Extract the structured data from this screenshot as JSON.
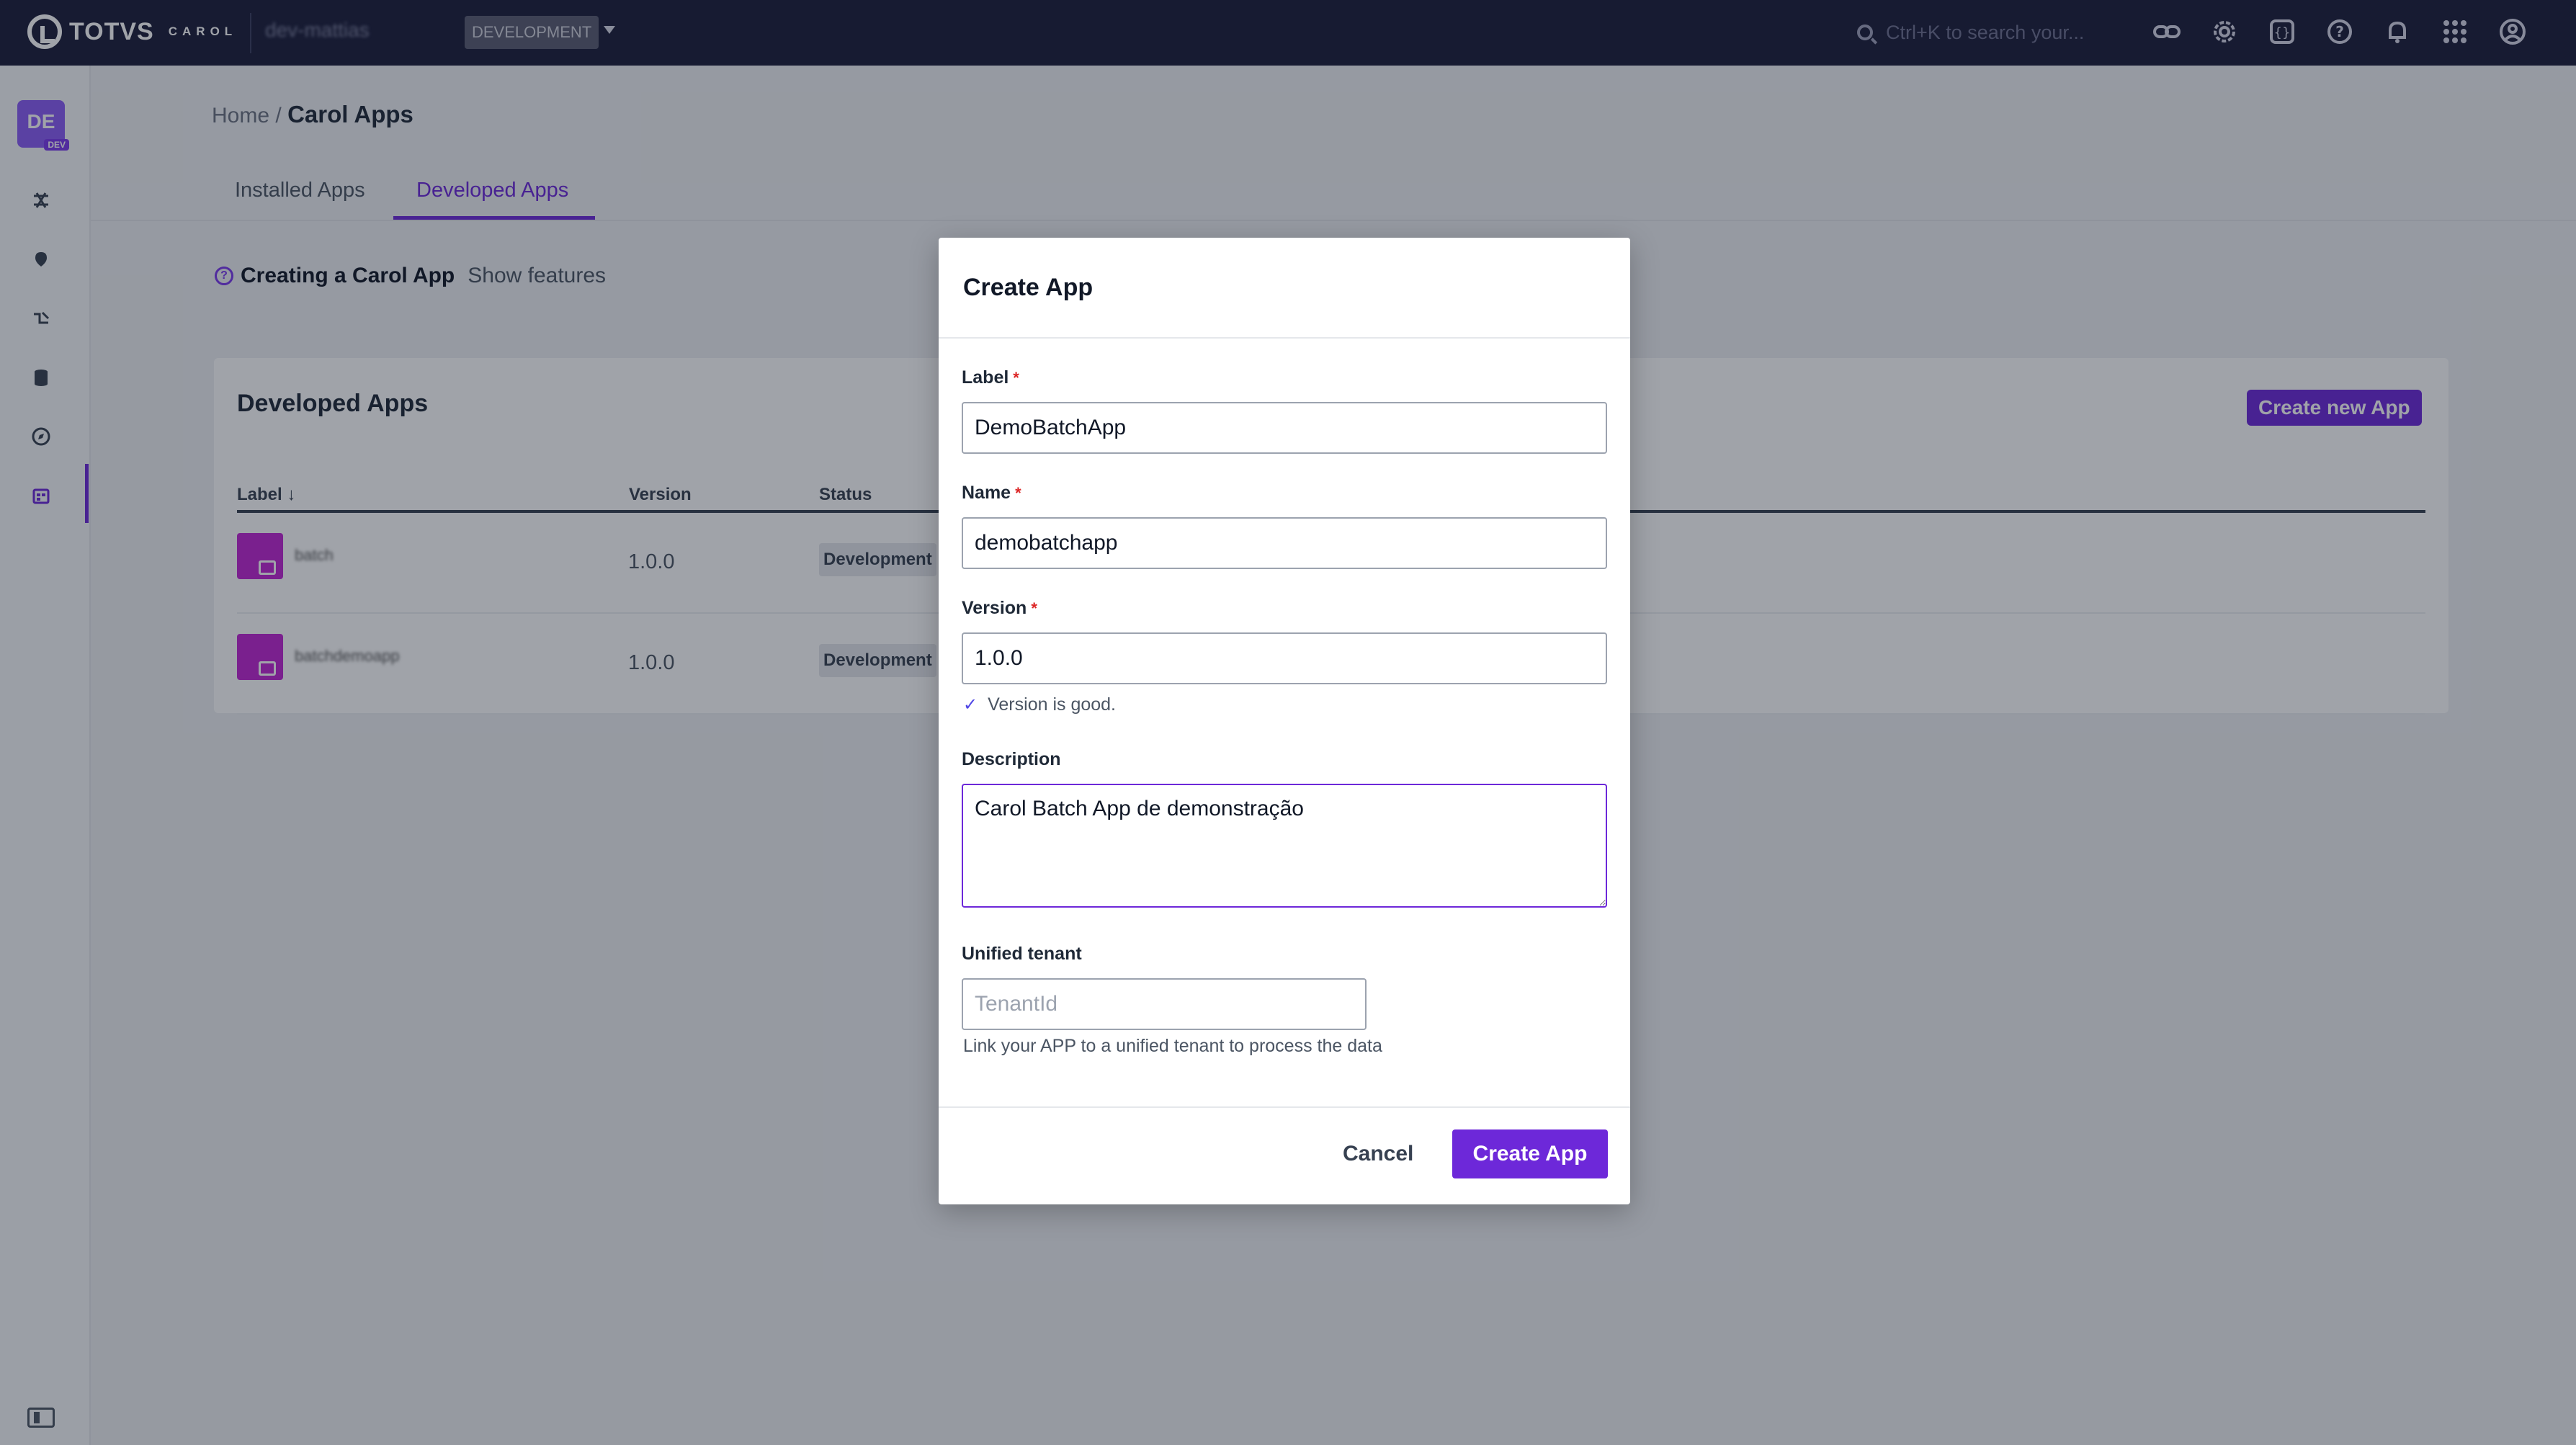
{
  "topbar": {
    "logo_text": "TOTVS",
    "logo_sub": "CAROL",
    "environment_name": "dev-mattias",
    "environment_badge": "DEVELOPMENT",
    "search_placeholder": "Ctrl+K to search your...",
    "icons": [
      "link-icon",
      "gear-icon",
      "code-braces-icon",
      "help-icon",
      "bell-icon",
      "apps-grid-icon",
      "user-circle-icon"
    ]
  },
  "sidebar": {
    "workspace_initials": "DE",
    "workspace_tag": "DEV",
    "items": [
      "connectors-icon",
      "pin-icon",
      "mapping-icon",
      "database-icon",
      "explore-icon",
      "apps-icon"
    ],
    "active_item": "apps-icon"
  },
  "breadcrumb": {
    "home": "Home",
    "separator": "/",
    "current": "Carol Apps"
  },
  "tabs": [
    {
      "label": "Installed Apps",
      "active": false
    },
    {
      "label": "Developed Apps",
      "active": true
    }
  ],
  "info": {
    "title": "Creating a Carol App",
    "link": "Show features"
  },
  "developed_apps": {
    "title": "Developed Apps",
    "create_button": "Create new App",
    "columns": {
      "label": "Label ↓",
      "version": "Version",
      "status": "Status"
    },
    "rows": [
      {
        "name": "batch",
        "version": "1.0.0",
        "status": "Development"
      },
      {
        "name": "batchdemoapp",
        "version": "1.0.0",
        "status": "Development"
      }
    ]
  },
  "modal": {
    "title": "Create App",
    "label_field": {
      "label": "Label",
      "required_mark": "*",
      "value": "DemoBatchApp"
    },
    "name_field": {
      "label": "Name",
      "required_mark": "*",
      "value": "demobatchapp"
    },
    "version_field": {
      "label": "Version",
      "required_mark": "*",
      "value": "1.0.0",
      "validation": "Version is good."
    },
    "description_field": {
      "label": "Description",
      "value": "Carol Batch App de demonstração"
    },
    "tenant_field": {
      "label": "Unified tenant",
      "placeholder": "TenantId",
      "help": "Link your APP to a unified tenant to process the data"
    },
    "cancel_button": "Cancel",
    "create_button": "Create App"
  },
  "colors": {
    "topbar": "#1b1d3a",
    "accent": "#6d28d9",
    "required": "#dc2626"
  }
}
